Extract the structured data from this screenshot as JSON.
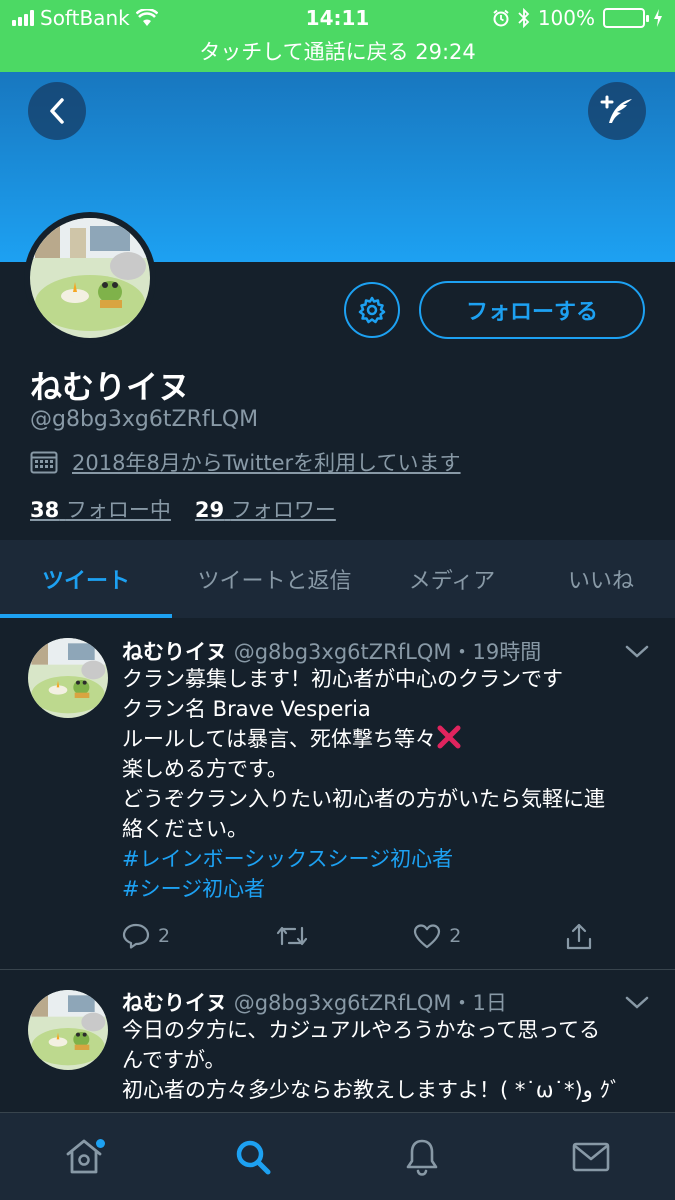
{
  "status_bar": {
    "carrier": "SoftBank",
    "time": "14:11",
    "battery": "100%"
  },
  "call_banner": "タッチして通話に戻る 29:24",
  "profile": {
    "display_name": "ねむりイヌ",
    "handle": "@g8bg3xg6tZRfLQM",
    "joined": "2018年8月からTwitterを利用しています",
    "following_count": "38",
    "following_label": "フォロー中",
    "followers_count": "29",
    "followers_label": "フォロワー",
    "follow_button": "フォローする"
  },
  "tabs": [
    {
      "label": "ツイート",
      "active": true
    },
    {
      "label": "ツイートと返信",
      "active": false
    },
    {
      "label": "メディア",
      "active": false
    },
    {
      "label": "いいね",
      "active": false
    }
  ],
  "tweets": [
    {
      "name": "ねむりイヌ",
      "meta": "@g8bg3xg6tZRfLQM・19時間",
      "lines": [
        "クラン募集します！初心者が中心のクランです",
        "クラン名 Brave Vesperia",
        "ルールしては暴言、死体撃ち等々",
        "楽しめる方です。",
        "どうぞクラン入りたい初心者の方がいたら気軽に連",
        "絡ください。"
      ],
      "hashtags": [
        "#レインボーシックスシージ初心者",
        "#シージ初心者"
      ],
      "replies": "2",
      "likes": "2"
    },
    {
      "name": "ねむりイヌ",
      "meta": "@g8bg3xg6tZRfLQM・1日",
      "lines": [
        "今日の夕方に、カジュアルやろうかなって思ってる",
        "んですが。",
        "初心者の方々多少ならお教えしますよ！( *˙ω˙*)و ｸﾞ"
      ]
    }
  ],
  "colors": {
    "accent": "#1da1f2",
    "background": "#15202b",
    "status_bar": "#4cd964",
    "secondary_text": "#8899a6"
  },
  "icons": {
    "back": "chevron-left-icon",
    "compose": "compose-feather-icon",
    "settings": "gear-icon",
    "calendar": "calendar-icon",
    "reply": "reply-icon",
    "retweet": "retweet-icon",
    "like": "heart-icon",
    "share": "share-icon",
    "nav": [
      "home-icon",
      "search-icon",
      "bell-icon",
      "mail-icon"
    ]
  }
}
